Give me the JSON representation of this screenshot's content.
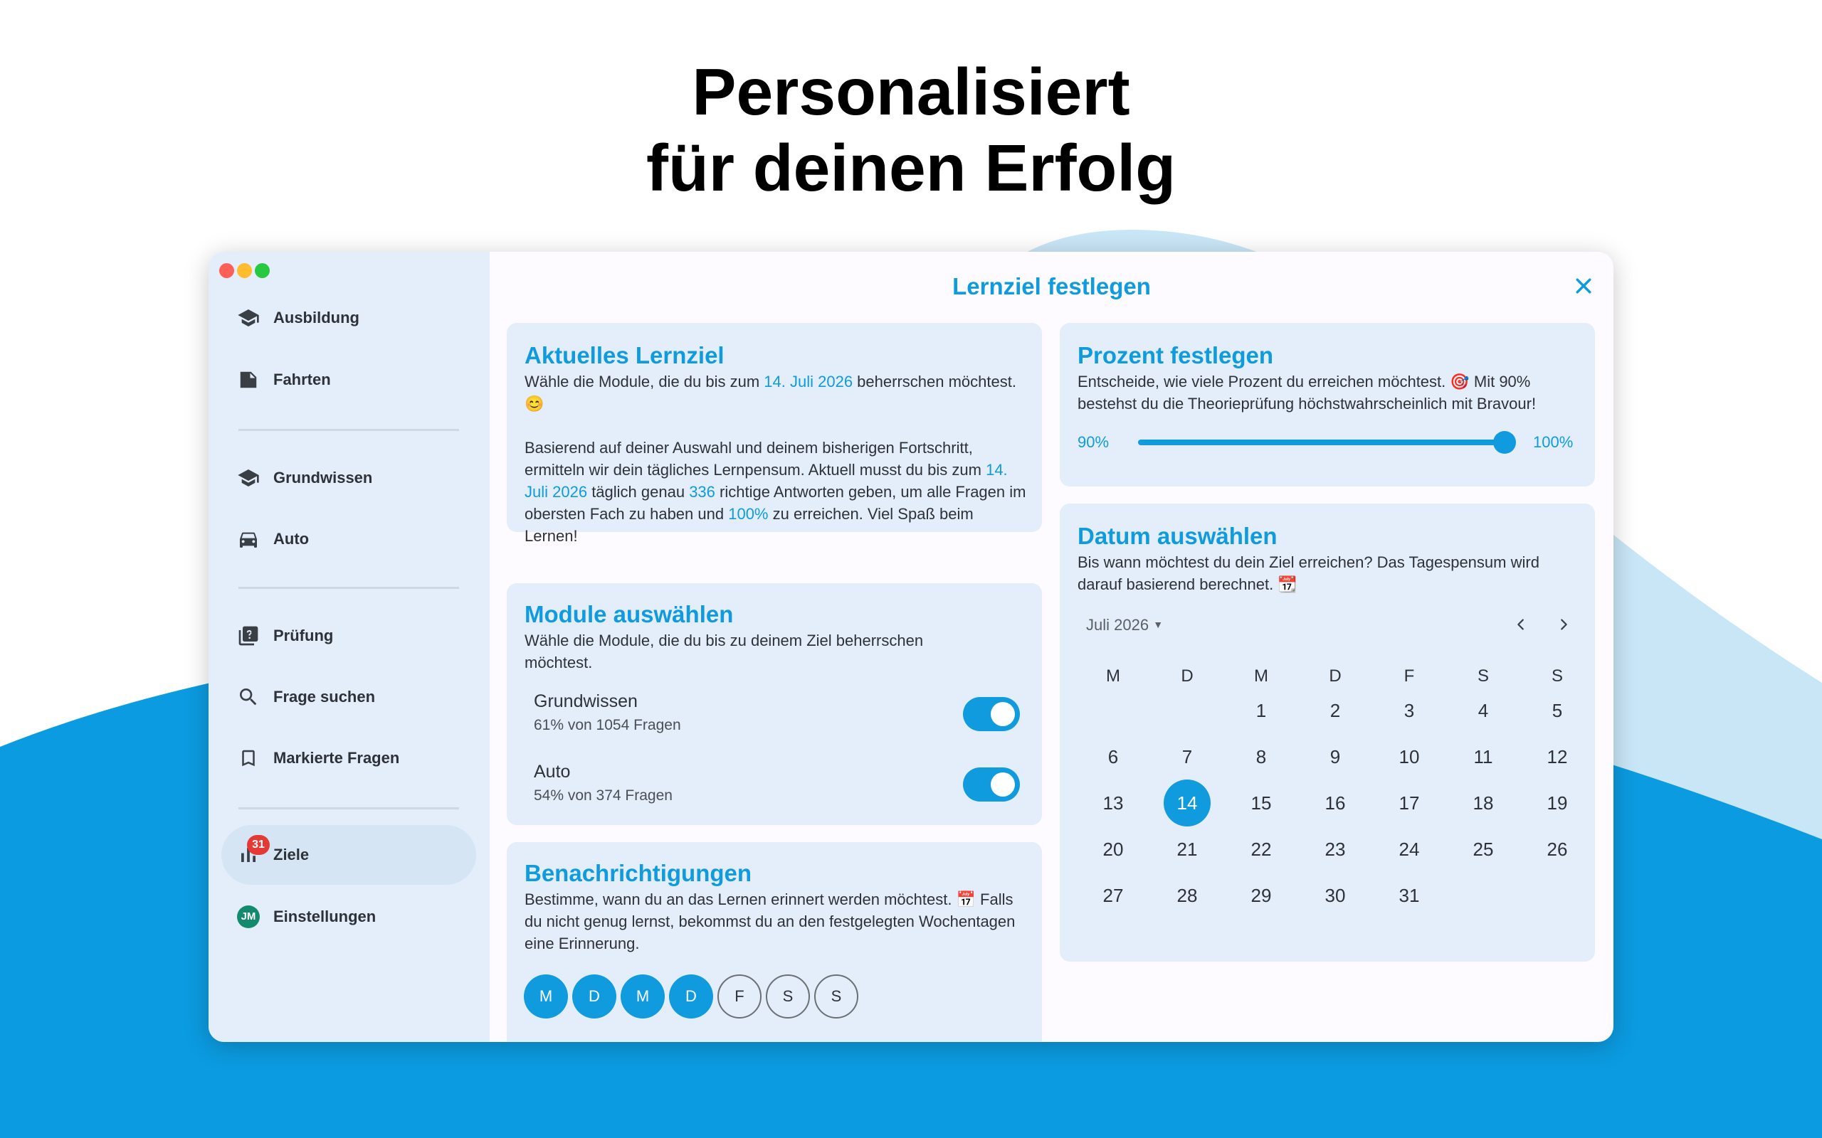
{
  "headline": {
    "line1": "Personalisiert",
    "line2": "für deinen Erfolg"
  },
  "colors": {
    "accent": "#0f9bde",
    "background_wave": "#0b9be0",
    "sidebar": "#e4eefa",
    "card": "#e3eefa",
    "badge": "#e53935"
  },
  "window": {
    "title": "Lernziel festlegen",
    "close_icon": "close-icon"
  },
  "sidebar": {
    "items": [
      {
        "label": "Ausbildung",
        "icon": "graduation-cap-icon"
      },
      {
        "label": "Fahrten",
        "icon": "note-icon"
      },
      {
        "label": "Grundwissen",
        "icon": "graduation-cap-icon"
      },
      {
        "label": "Auto",
        "icon": "car-icon"
      },
      {
        "label": "Prüfung",
        "icon": "quiz-icon"
      },
      {
        "label": "Frage suchen",
        "icon": "search-icon"
      },
      {
        "label": "Markierte Fragen",
        "icon": "bookmark-icon"
      },
      {
        "label": "Ziele",
        "icon": "bar-chart-icon",
        "badge": "31",
        "active": true
      },
      {
        "label": "Einstellungen",
        "icon": "avatar",
        "avatar_initials": "JM"
      }
    ]
  },
  "current_goal": {
    "title": "Aktuelles Lernziel",
    "p1_a": "Wähle die Module, die du bis zum ",
    "p1_date": "14. Juli 2026",
    "p1_b": " beherrschen möchtest. 😊",
    "p2_a": "Basierend auf deiner Auswahl und deinem bisherigen Fortschritt, ermitteln wir dein tägliches Lernpensum. Aktuell musst du bis zum ",
    "p2_date": "14. Juli 2026",
    "p2_b": " täglich genau ",
    "p2_count": "336",
    "p2_c": " richtige Antworten geben, um alle Fragen im obersten Fach zu haben und ",
    "p2_pct": "100%",
    "p2_d": " zu erreichen. Viel Spaß beim Lernen!"
  },
  "modules": {
    "title": "Module auswählen",
    "text": "Wähle die Module, die du bis zu deinem Ziel beherrschen möchtest.",
    "items": [
      {
        "name": "Grundwissen",
        "sub": "61% von 1054 Fragen",
        "enabled": true
      },
      {
        "name": "Auto",
        "sub": "54% von 374 Fragen",
        "enabled": true
      }
    ]
  },
  "notifications": {
    "title": "Benachrichtigungen",
    "text": "Bestimme, wann du an das Lernen erinnert werden möchtest. 📅 Falls du nicht genug lernst, bekommst du an den festgelegten Wochentagen eine Erinnerung.",
    "days": [
      {
        "label": "M",
        "on": true
      },
      {
        "label": "D",
        "on": true
      },
      {
        "label": "M",
        "on": true
      },
      {
        "label": "D",
        "on": true
      },
      {
        "label": "F",
        "on": false
      },
      {
        "label": "S",
        "on": false
      },
      {
        "label": "S",
        "on": false
      }
    ]
  },
  "percent": {
    "title": "Prozent festlegen",
    "text": "Entscheide, wie viele Prozent du erreichen möchtest. 🎯 Mit 90% bestehst du die Theorieprüfung höchstwahrscheinlich mit Bravour!",
    "min_label": "90%",
    "max_label": "100%",
    "value": 100
  },
  "date": {
    "title": "Datum auswählen",
    "text": "Bis wann möchtest du dein Ziel erreichen? Das Tagespensum wird darauf basierend berechnet. 📆",
    "month": "Juli 2026",
    "weekdays": [
      "M",
      "D",
      "M",
      "D",
      "F",
      "S",
      "S"
    ],
    "first_weekday_index": 2,
    "days_in_month": 31,
    "selected_day": 14
  }
}
